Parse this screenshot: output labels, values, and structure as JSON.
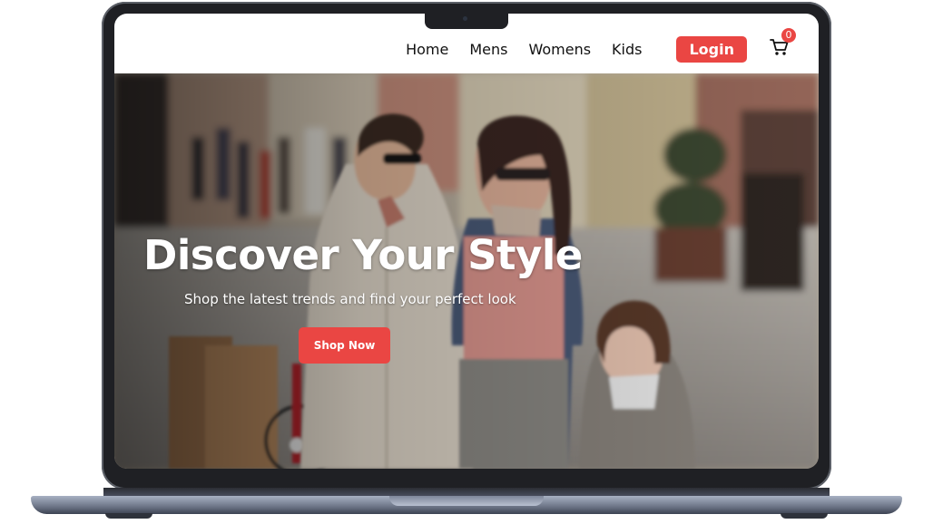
{
  "nav": {
    "links": [
      "Home",
      "Mens",
      "Womens",
      "Kids"
    ],
    "login_label": "Login",
    "cart_count": "0",
    "cart_icon": "shopping-cart-icon"
  },
  "hero": {
    "title": "Discover Your Style",
    "subtitle": "Shop the latest trends and find your perfect look",
    "cta_label": "Shop Now",
    "image": "photo of women and a girl walking on a city street"
  },
  "colors": {
    "accent": "#ea4643",
    "navbar_bg": "#ffffff",
    "laptop_frame": "#1f2024"
  }
}
